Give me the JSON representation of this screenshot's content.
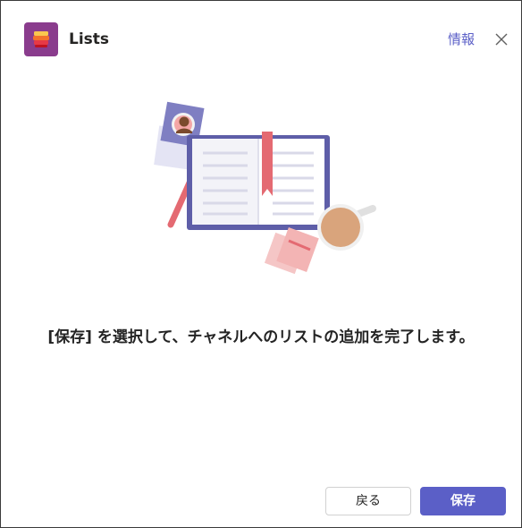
{
  "header": {
    "app_title": "Lists",
    "about_label": "情報",
    "app_icon": "lists-app-icon",
    "close_icon": "close-icon"
  },
  "illustration": {
    "icon": "open-book-illustration"
  },
  "main": {
    "message": "[保存] を選択して、チャネルへのリストの追加を完了します。"
  },
  "footer": {
    "back_label": "戻る",
    "save_label": "保存"
  },
  "colors": {
    "accent": "#5b5fc7",
    "app_icon_bg": "#8a3c8d"
  }
}
